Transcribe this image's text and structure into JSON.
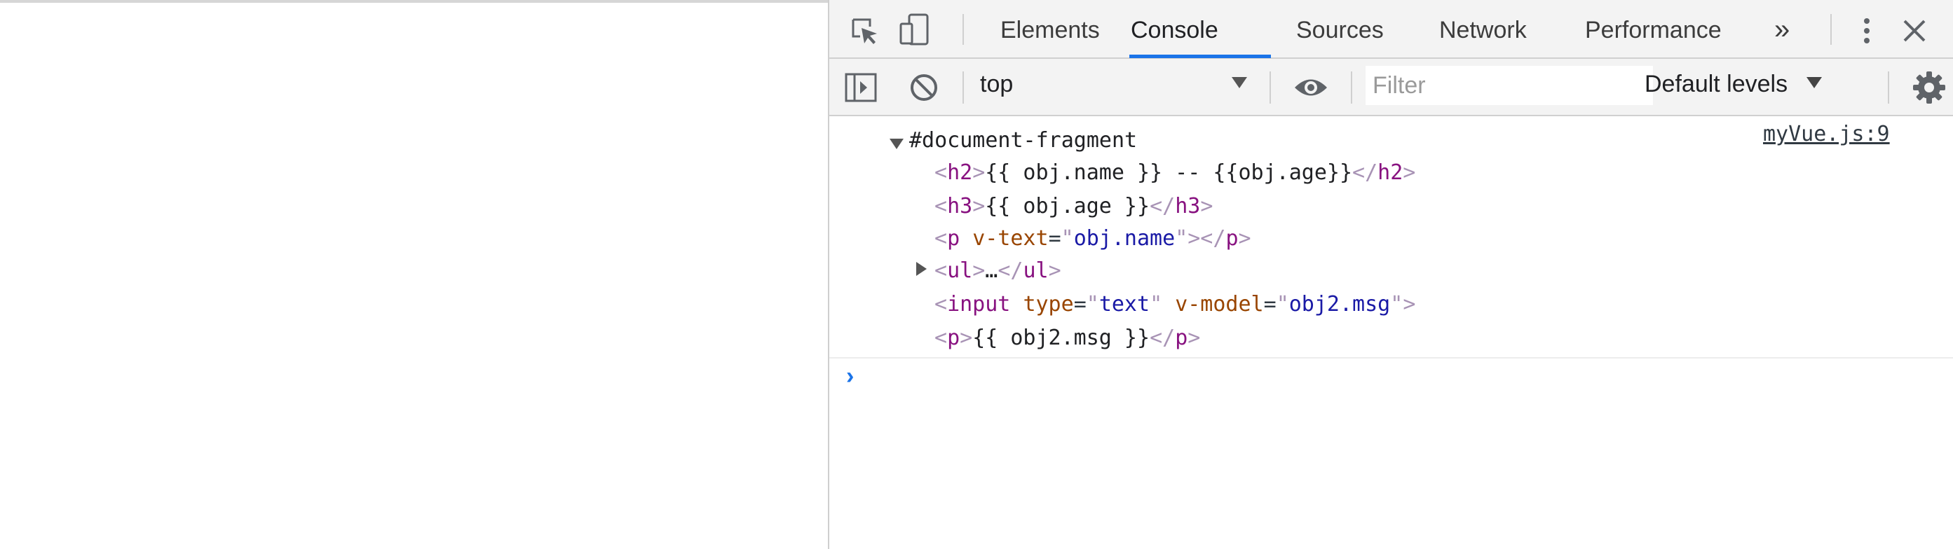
{
  "devtools": {
    "tabs": {
      "elements": "Elements",
      "console": "Console",
      "sources": "Sources",
      "network": "Network",
      "performance": "Performance",
      "more": "»"
    },
    "toolbar": {
      "context": "top",
      "filter_placeholder": "Filter",
      "levels": "Default levels"
    },
    "console": {
      "source_link": "myVue.js:9",
      "root": "#document-fragment",
      "lines": {
        "h2": {
          "open": "h2",
          "text": "{{ obj.name }} -- {{obj.age}}",
          "close": "h2"
        },
        "h3": {
          "open": "h3",
          "text": "{{ obj.age }}",
          "close": "h3"
        },
        "p1": {
          "tag": "p",
          "attr": "v-text",
          "value": "obj.name"
        },
        "ul": {
          "open": "ul",
          "ellipsis": "…",
          "close": "ul"
        },
        "input": {
          "tag": "input",
          "attr1": "type",
          "value1": "text",
          "attr2": "v-model",
          "value2": "obj2.msg"
        },
        "p2": {
          "open": "p",
          "text": "{{ obj2.msg }}",
          "close": "p"
        }
      },
      "prompt": "›"
    },
    "colors": {
      "accent": "#1a73e8",
      "tag": "#881280",
      "attribute": "#994500",
      "attribute_value": "#1a1aa6"
    },
    "icons": [
      "inspect-icon",
      "device-toggle-icon",
      "kebab-menu-icon",
      "close-icon",
      "sidebar-toggle-icon",
      "clear-console-icon",
      "eye-icon",
      "gear-icon"
    ]
  }
}
